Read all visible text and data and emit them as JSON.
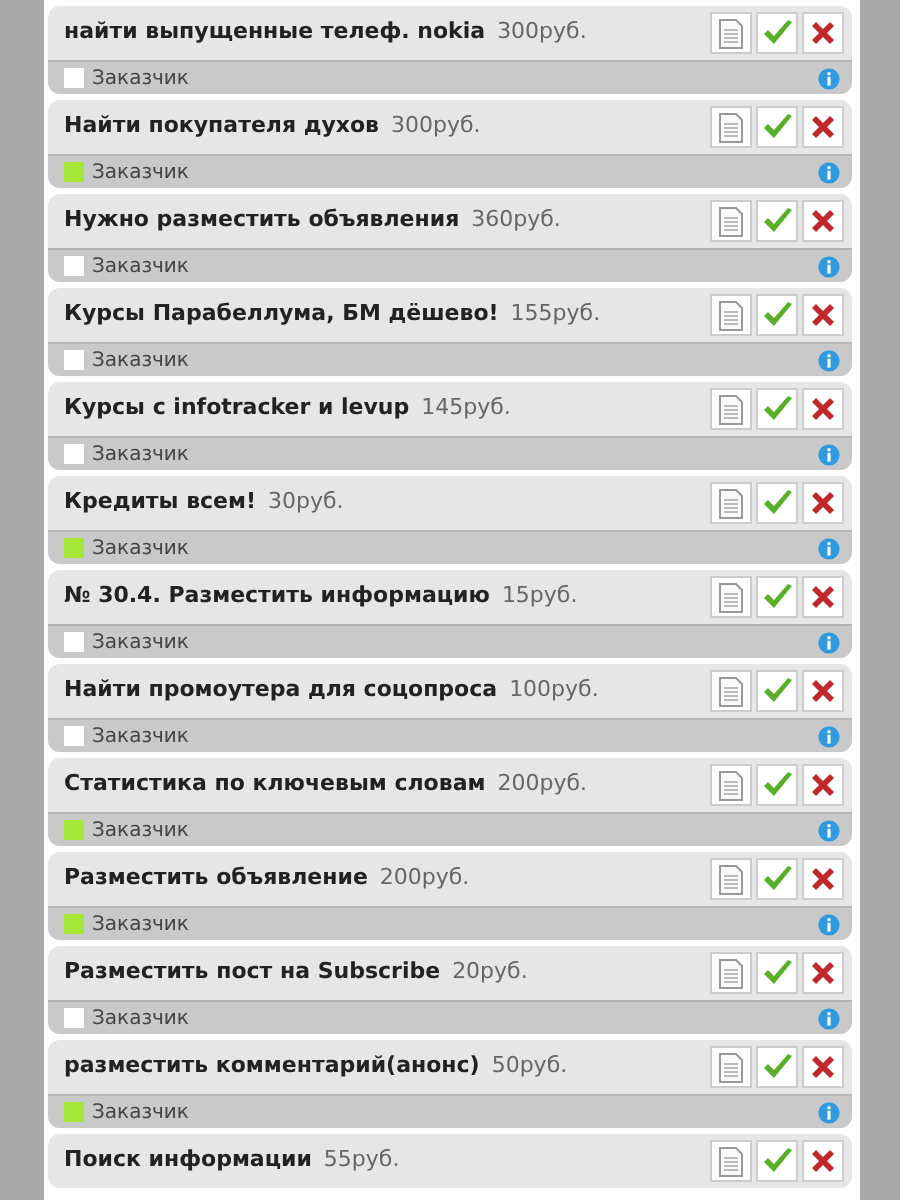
{
  "tasks": [
    {
      "title": "найти выпущенные телеф. nokia",
      "price": "300руб.",
      "customer": "Заказчик",
      "customer_online": false
    },
    {
      "title": "Найти покупателя духов",
      "price": "300руб.",
      "customer": "Заказчик",
      "customer_online": true
    },
    {
      "title": "Нужно разместить объявления",
      "price": "360руб.",
      "customer": "Заказчик",
      "customer_online": false
    },
    {
      "title": "Курсы Парабеллума, БМ дёшево!",
      "price": "155руб.",
      "customer": "Заказчик",
      "customer_online": false
    },
    {
      "title": "Курсы с infotracker и levup",
      "price": "145руб.",
      "customer": "Заказчик",
      "customer_online": false
    },
    {
      "title": "Кредиты всем!",
      "price": "30руб.",
      "customer": "Заказчик",
      "customer_online": true
    },
    {
      "title": "№ 30.4. Разместить информацию",
      "price": "15руб.",
      "customer": "Заказчик",
      "customer_online": false
    },
    {
      "title": "Найти промоутера для соцопроса",
      "price": "100руб.",
      "customer": "Заказчик",
      "customer_online": false
    },
    {
      "title": "Статистика по ключевым словам",
      "price": "200руб.",
      "customer": "Заказчик",
      "customer_online": true
    },
    {
      "title": "Разместить объявление",
      "price": "200руб.",
      "customer": "Заказчик",
      "customer_online": true
    },
    {
      "title": "Разместить пост на Subscribe",
      "price": "20руб.",
      "customer": "Заказчик",
      "customer_online": false
    },
    {
      "title": "разместить комментарий(анонс)",
      "price": "50руб.",
      "customer": "Заказчик",
      "customer_online": true
    },
    {
      "title": "Поиск информации",
      "price": "55руб."
    }
  ]
}
